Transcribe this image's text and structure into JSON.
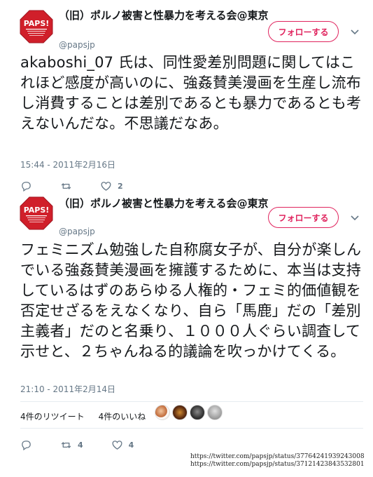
{
  "tweets": [
    {
      "display_name": "（旧）ポルノ被害と性暴力を考える会@東京",
      "handle": "@papsjp",
      "follow_label": "フォローする",
      "text": "akaboshi_07 氏は、同性愛差別問題に関してはこれほど感度が高いのに、強姦賛美漫画を生産し流布し消費することは差別であるとも暴力であるとも考えないんだな。不思議だなあ。",
      "timestamp": "15:44 - 2011年2月16日",
      "reply_count": "",
      "retweet_count": "",
      "like_count": "2"
    },
    {
      "display_name": "（旧）ポルノ被害と性暴力を考える会@東京",
      "handle": "@papsjp",
      "follow_label": "フォローする",
      "text": "フェミニズム勉強した自称腐女子が、自分が楽しんでいる強姦賛美漫画を擁護するために、本当は支持しているはずのあらゆる人権的・フェミ的価値観を否定せざるをえなくなり、自ら「馬鹿」だの「差別主義者」だのと名乗り、１０００人ぐらい調査して示せと、２ちゃんねる的議論を吹っかけてくる。",
      "timestamp": "21:10 - 2011年2月14日",
      "retweets_label": "4件のリツイート",
      "likes_label": "4件のいいね",
      "reply_count": "",
      "retweet_count": "4",
      "like_count": "4"
    }
  ],
  "avatar_text": "PAPS!",
  "urls": [
    "https://twitter.com/papsjp/status/37764241939243008",
    "https://twitter.com/papsjp/status/37121423843532801"
  ],
  "colors": {
    "accent": "#e0245e",
    "muted": "#657786",
    "text": "#14171a",
    "avatar_red": "#d01f2a"
  },
  "icons": [
    "reply-icon",
    "retweet-icon",
    "like-icon",
    "chevron-down-icon"
  ]
}
